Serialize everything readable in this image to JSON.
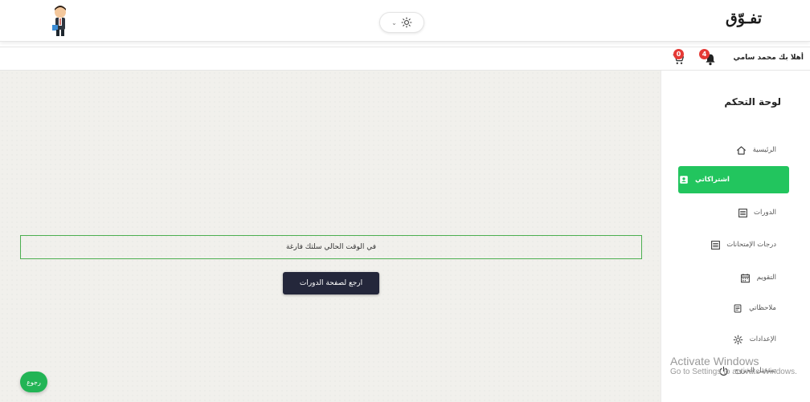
{
  "header": {
    "logo_text": "تفـوّق",
    "theme_icon": "sun-icon",
    "theme_chevron": "⌄",
    "avatar_icon": "user-avatar-icon"
  },
  "subheader": {
    "greeting": "أهلا بك محمد سامي",
    "notifications_count": "4",
    "cart_count": "0"
  },
  "main": {
    "notice_text": "في الوقت الحالي سلتك فارغة",
    "back_to_courses_label": "ارجع لصفحة الدورات",
    "back_button_label": "رجوع"
  },
  "sidebar": {
    "title": "لوحة التحكم",
    "items": [
      {
        "label": "الرئيسية",
        "icon": "home-icon",
        "active": false
      },
      {
        "label": "اشتراكاتي",
        "icon": "subscriptions-icon",
        "active": true
      },
      {
        "label": "الدورات",
        "icon": "courses-icon",
        "active": false
      },
      {
        "label": "درجات الإمتحانات",
        "icon": "exam-grades-icon",
        "active": false
      },
      {
        "label": "التقويم",
        "icon": "calendar-icon",
        "active": false
      },
      {
        "label": "ملاحظاتي",
        "icon": "notes-icon",
        "active": false
      },
      {
        "label": "الإعدادات",
        "icon": "settings-icon",
        "active": false
      },
      {
        "label": "تسجيل الخروج",
        "icon": "logout-icon",
        "active": false
      }
    ]
  },
  "watermark": {
    "line1": "Activate Windows",
    "line2": "Go to Settings to activate Windows."
  },
  "colors": {
    "accent": "#22c55e",
    "dark_button": "#24273b",
    "badge": "#e53935",
    "main_bg": "#f1f0ec"
  }
}
